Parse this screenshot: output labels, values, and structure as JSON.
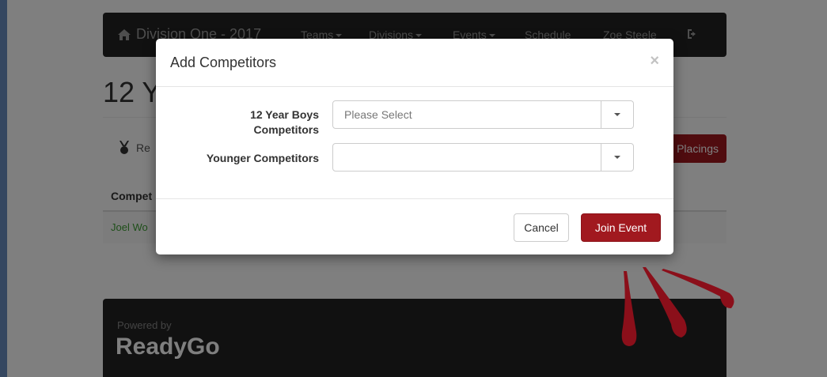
{
  "navbar": {
    "brand": "Division One - 2017",
    "items": [
      "Teams",
      "Divisions",
      "Events",
      "Schedule"
    ],
    "user": "Zoe Steele"
  },
  "page": {
    "title": "12 Y",
    "results_tab": "Re",
    "placings_button": "Placings",
    "table_header": "Compet",
    "table_row": "Joel Wo"
  },
  "footer": {
    "powered_by": "Powered by",
    "logo": "ReadyGo"
  },
  "modal": {
    "title": "Add Competitors",
    "close": "×",
    "field1_label": "12 Year Boys Competitors",
    "field1_placeholder": "Please Select",
    "field2_label": "Younger Competitors",
    "field2_value": "",
    "cancel_label": "Cancel",
    "join_label": "Join Event"
  },
  "colors": {
    "accent": "#a1191f",
    "navbar": "#222222",
    "annotation": "#8b0f1a"
  }
}
